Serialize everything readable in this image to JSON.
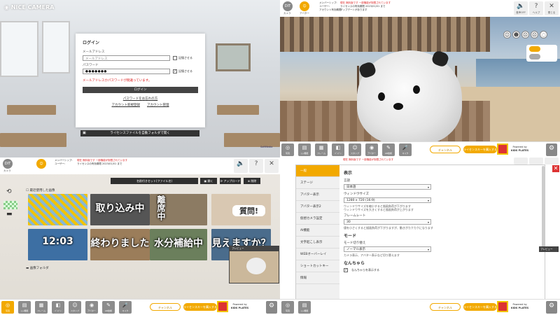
{
  "login": {
    "brand": "NICE CAMERA",
    "title": "ログイン",
    "email_label": "メールアドレス",
    "email_placeholder": "メールアドレス",
    "remember_email": "記憶させる",
    "password_label": "パスワード",
    "password_value": "●●●●●●●",
    "remember_password": "記憶させる",
    "error": "メールアドレスかパスワードが間違っています。",
    "login_button": "ログイン",
    "forgot_link": "パスワードをお忘れの方",
    "register_link": "アカウント新規登録",
    "account_link": "アカウント管理",
    "license_button": "ライセンスファイルを自動フォルダで開く",
    "soft_logo": "SoftMedia"
  },
  "topbar": {
    "btn1": "DIT",
    "btn1_label": "カメラ",
    "btn2_label": "アバター",
    "btn3_label": "背景",
    "status_lines": [
      "メンバーシップ:",
      "ユーザー:",
      "アカウント有効期限:"
    ],
    "notice_red": "現在 無料版です 一部機能が制限されています",
    "notice_black": "ライセンスの有効期限 2023/01/01 まで",
    "notice_extra": "アップデートがあります",
    "mute_label": "音声OFF",
    "help_label": "ヘルプ",
    "close_label": "閉じる"
  },
  "toolbar": {
    "tools": [
      {
        "icon": "◎",
        "label": "写真"
      },
      {
        "icon": "▤",
        "label": "ｼｮｰ機能"
      },
      {
        "icon": "▦",
        "label": "フレーム"
      },
      {
        "icon": "◧",
        "label": "ﾊﾟﾝﾌﾟﾝ"
      },
      {
        "icon": "☺",
        "label": "スタンプ"
      },
      {
        "icon": "◉",
        "label": "アバター"
      },
      {
        "icon": "✎",
        "label": "AR技術"
      },
      {
        "icon": "🎤",
        "label": "マイク"
      }
    ],
    "pill_outline": "チャンネル",
    "pill_fill": "ライセンスキーを購入する",
    "powered_line1": "Powered by",
    "powered_line2": "KIDS PLATES",
    "gear_label": "設定"
  },
  "folder": {
    "path": "名前付きセット(ファイル名)",
    "btn_open": "開く",
    "btn_upload": "アップロード",
    "btn_delete": "削除",
    "recent_label": "最近使用した画像",
    "thumbs": [
      "",
      "取り込み中",
      "離席中",
      "質問!",
      "12:03",
      "終わりました",
      "水分補給中",
      "見えますか？"
    ],
    "preview_label": "プレビュー",
    "folder_label": "画像フォルダ"
  },
  "settings": {
    "menu": [
      "一般",
      "ステージ",
      "アバター表示",
      "アバター表示2",
      "仮想カメラ設定",
      "AI機能",
      "文字起こし表示",
      "WEBオーバーレイ",
      "ショートカットキー",
      "情報"
    ],
    "section_display": "表示",
    "lang_label": "言語",
    "lang_value": "日本語",
    "window_size_label": "ウィンドウサイズ",
    "window_size_value": "1280 x 720 (16:9)",
    "window_note1": "ウィンドウサイズを縮小すると描画負荷が下がります",
    "window_note2": "ウィンドウサイズを大きくすると描画負荷が上がります",
    "framerate_label": "フレームレート",
    "framerate_value": "30",
    "framerate_note": "値を小さくすると描画負荷が下がりますが、動きがカクカクになります",
    "section_mode": "モード",
    "mode_label": "モード切り替え",
    "mode_value": "ノーマル表示",
    "mode_note": "カメラ表示、アバター表示など切り替えます",
    "section_other": "なんちゃら",
    "checkbox_label": "なんちゃらを表示する",
    "preview_tag": "プレビュー"
  },
  "colors": {
    "accent": "#f2a900",
    "error": "#dd2222",
    "dark": "#2f2f2f"
  }
}
